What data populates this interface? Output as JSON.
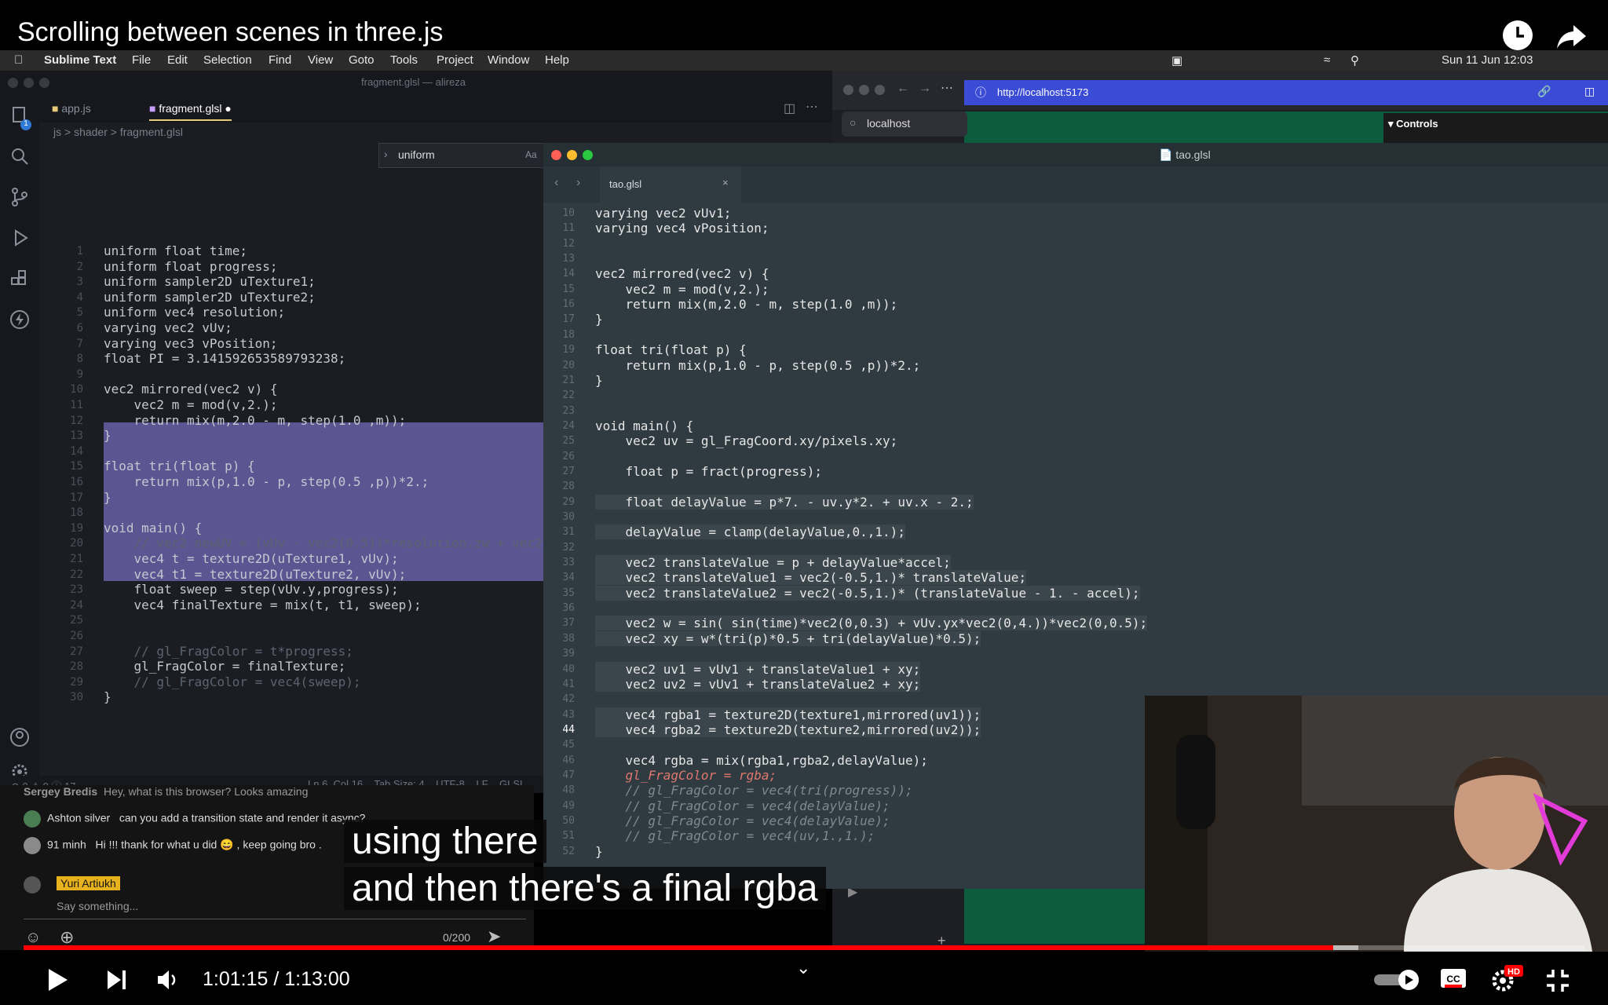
{
  "video": {
    "title": "Scrolling between scenes in three.js",
    "time_current": "1:01:15",
    "time_separator": " / ",
    "time_total": "1:13:00",
    "played_fraction": 0.839,
    "buffered_fraction": 0.855
  },
  "captions": {
    "line1": "using there",
    "line2": "and then there's a final rgba"
  },
  "menubar": {
    "app": "Sublime Text",
    "items": [
      "File",
      "Edit",
      "Selection",
      "Find",
      "View",
      "Goto",
      "Tools",
      "Project",
      "Window",
      "Help"
    ],
    "datetime": "Sun 11 Jun  12:03"
  },
  "vscode": {
    "title": "fragment.glsl — alireza",
    "tabs": [
      "app.js",
      "fragment.glsl"
    ],
    "breadcrumb": "js  >  shader  >  fragment.glsl",
    "find_value": "uniform",
    "find_option": "Aa",
    "badge": "1",
    "lines": [
      {
        "n": "1",
        "t": "uniform float time;"
      },
      {
        "n": "2",
        "t": "uniform float progress;"
      },
      {
        "n": "3",
        "t": "uniform sampler2D uTexture1;"
      },
      {
        "n": "4",
        "t": "uniform sampler2D uTexture2;"
      },
      {
        "n": "5",
        "t": "uniform vec4 resolution;"
      },
      {
        "n": "6",
        "t": "varying vec2 vUv;"
      },
      {
        "n": "7",
        "t": "varying vec3 vPosition;"
      },
      {
        "n": "8",
        "t": "float PI = 3.141592653589793238;"
      },
      {
        "n": "9",
        "t": ""
      },
      {
        "n": "10",
        "t": "vec2 mirrored(vec2 v) {"
      },
      {
        "n": "11",
        "t": "    vec2 m = mod(v,2.);"
      },
      {
        "n": "12",
        "t": "    return mix(m,2.0 - m, step(1.0 ,m));"
      },
      {
        "n": "13",
        "t": "}"
      },
      {
        "n": "14",
        "t": ""
      },
      {
        "n": "15",
        "t": "float tri(float p) {"
      },
      {
        "n": "16",
        "t": "    return mix(p,1.0 - p, step(0.5 ,p))*2.;"
      },
      {
        "n": "17",
        "t": "}"
      },
      {
        "n": "18",
        "t": ""
      },
      {
        "n": "19",
        "t": "void main() {"
      },
      {
        "n": "20",
        "t": "    // vec2 newUV = (vUv - vec2(0.5))*resolution.zw + vec2("
      },
      {
        "n": "21",
        "t": "    vec4 t = texture2D(uTexture1, vUv);"
      },
      {
        "n": "22",
        "t": "    vec4 t1 = texture2D(uTexture2, vUv);"
      },
      {
        "n": "23",
        "t": "    float sweep = step(vUv.y,progress);"
      },
      {
        "n": "24",
        "t": "    vec4 finalTexture = mix(t, t1, sweep);"
      },
      {
        "n": "25",
        "t": ""
      },
      {
        "n": "26",
        "t": ""
      },
      {
        "n": "27",
        "t": "    // gl_FragColor = t*progress;"
      },
      {
        "n": "28",
        "t": "    gl_FragColor = finalTexture;"
      },
      {
        "n": "29",
        "t": "    // gl_FragColor = vec4(sweep);"
      },
      {
        "n": "30",
        "t": "}"
      }
    ],
    "status_left": "⊗ 0 ⚠ 0 ⓘ 17",
    "status_right": "Ln 6, Col 16    Tab Size: 4    UTF-8    LF    GLSL"
  },
  "chat": {
    "messages": [
      {
        "author": "Sergey Bredis",
        "text": "Hey, what is this browser? Looks amazing",
        "avatar": "#6b6b6b"
      },
      {
        "author": "Ashton silver",
        "text": "can you add a transition state and render it async?",
        "avatar": "#4a7d52"
      },
      {
        "author": "91 minh",
        "text": "Hi !!! thank for what u did 😄 , keep going bro .",
        "avatar": "#8a8a8a"
      }
    ],
    "user": "Yuri Artiukh",
    "placeholder": "Say something...",
    "counter": "0/200"
  },
  "browser": {
    "url": "http://localhost:5173",
    "tab": "localhost",
    "controls": "Controls"
  },
  "sublime": {
    "title": "tao.glsl",
    "tab": "tao.glsl",
    "lines": [
      {
        "n": "10",
        "t": "varying vec2 vUv1;"
      },
      {
        "n": "11",
        "t": "varying vec4 vPosition;"
      },
      {
        "n": "12",
        "t": ""
      },
      {
        "n": "13",
        "t": ""
      },
      {
        "n": "14",
        "t": "vec2 mirrored(vec2 v) {"
      },
      {
        "n": "15",
        "t": "    vec2 m = mod(v,2.);"
      },
      {
        "n": "16",
        "t": "    return mix(m,2.0 - m, step(1.0 ,m));"
      },
      {
        "n": "17",
        "t": "}"
      },
      {
        "n": "18",
        "t": ""
      },
      {
        "n": "19",
        "t": "float tri(float p) {"
      },
      {
        "n": "20",
        "t": "    return mix(p,1.0 - p, step(0.5 ,p))*2.;"
      },
      {
        "n": "21",
        "t": "}"
      },
      {
        "n": "22",
        "t": ""
      },
      {
        "n": "23",
        "t": ""
      },
      {
        "n": "24",
        "t": "void main() {"
      },
      {
        "n": "25",
        "t": "    vec2 uv = gl_FragCoord.xy/pixels.xy;"
      },
      {
        "n": "26",
        "t": ""
      },
      {
        "n": "27",
        "t": "    float p = fract(progress);"
      },
      {
        "n": "28",
        "t": ""
      },
      {
        "n": "29",
        "t": "    float delayValue = p*7. - uv.y*2. + uv.x - 2.;"
      },
      {
        "n": "30",
        "t": ""
      },
      {
        "n": "31",
        "t": "    delayValue = clamp(delayValue,0.,1.);"
      },
      {
        "n": "32",
        "t": ""
      },
      {
        "n": "33",
        "t": "    vec2 translateValue = p + delayValue*accel;"
      },
      {
        "n": "34",
        "t": "    vec2 translateValue1 = vec2(-0.5,1.)* translateValue;"
      },
      {
        "n": "35",
        "t": "    vec2 translateValue2 = vec2(-0.5,1.)* (translateValue - 1. - accel);"
      },
      {
        "n": "36",
        "t": ""
      },
      {
        "n": "37",
        "t": "    vec2 w = sin( sin(time)*vec2(0,0.3) + vUv.yx*vec2(0,4.))*vec2(0,0.5);"
      },
      {
        "n": "38",
        "t": "    vec2 xy = w*(tri(p)*0.5 + tri(delayValue)*0.5);"
      },
      {
        "n": "39",
        "t": ""
      },
      {
        "n": "40",
        "t": "    vec2 uv1 = vUv1 + translateValue1 + xy;"
      },
      {
        "n": "41",
        "t": "    vec2 uv2 = vUv1 + translateValue2 + xy;"
      },
      {
        "n": "42",
        "t": ""
      },
      {
        "n": "43",
        "t": "    vec4 rgba1 = texture2D(texture1,mirrored(uv1));"
      },
      {
        "n": "44",
        "t": "    vec4 rgba2 = texture2D(texture2,mirrored(uv2));"
      },
      {
        "n": "45",
        "t": ""
      },
      {
        "n": "46",
        "t": "    vec4 rgba = mix(rgba1,rgba2,delayValue);"
      },
      {
        "n": "47",
        "t": "    gl_FragColor = rgba;"
      },
      {
        "n": "48",
        "t": "    // gl_FragColor = vec4(tri(progress));"
      },
      {
        "n": "49",
        "t": "    // gl_FragColor = vec4(delayValue);"
      },
      {
        "n": "50",
        "t": "    // gl_FragColor = vec4(delayValue);"
      },
      {
        "n": "51",
        "t": "    // gl_FragColor = vec4(uv,1.,1.);"
      },
      {
        "n": "52",
        "t": "}"
      }
    ]
  },
  "colors": {
    "accent_red": "#ff0000",
    "selection": "#5b5592",
    "sublime_bg": "#2f3b41",
    "url_bar": "#3a4bd6"
  },
  "icons": [
    "clock-icon",
    "share-icon",
    "play-icon",
    "next-icon",
    "volume-icon",
    "autoplay-toggle-icon",
    "cc-icon",
    "settings-icon",
    "exit-fullscreen-icon",
    "chevron-down-icon"
  ],
  "hd_badge": "HD",
  "cc_label": "CC"
}
